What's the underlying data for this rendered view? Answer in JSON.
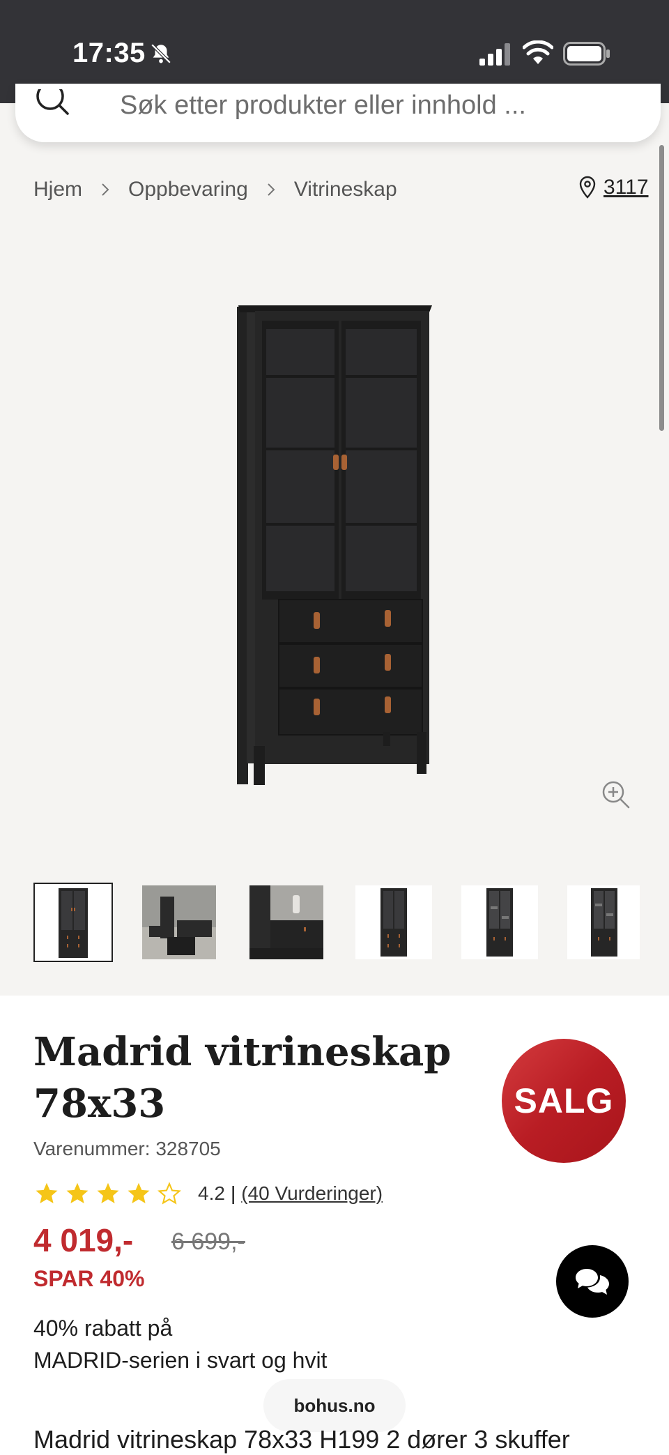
{
  "status_bar": {
    "time": "17:35"
  },
  "search": {
    "placeholder": "Søk etter produkter eller innhold ..."
  },
  "breadcrumb": [
    "Hjem",
    "Oppbevaring",
    "Vitrineskap"
  ],
  "store": {
    "number": "3117"
  },
  "product": {
    "title_line1": "Madrid vitrineskap",
    "title_line2": "78x33",
    "sku": "Varenummer: 328705",
    "rating": {
      "score": "4.2",
      "separator": "|",
      "count_label": "(40 Vurderinger)",
      "stars": 4.2
    },
    "price": "4 019,-",
    "old_price": "6 699,-",
    "save_label": "SPAR 40%",
    "promo_line1": "40% rabatt på",
    "promo_line2": "MADRID-serien i svart og hvit",
    "description": "Madrid vitrineskap 78x33 H199 2 dører 3 skuffer"
  },
  "badges": {
    "sale": "SALG"
  },
  "thumbnails": {
    "count": 6,
    "selected_index": 0
  },
  "footer": {
    "domain": "bohus.no"
  },
  "colors": {
    "accent_red": "#c02b2f",
    "status_bar": "#333337",
    "star": "#f5c518"
  },
  "icons": [
    "bell-slash-icon",
    "cellular-signal-icon",
    "wifi-icon",
    "battery-icon",
    "search-icon",
    "chevron-right-icon",
    "location-pin-icon",
    "zoom-in-icon",
    "chat-icon",
    "star-icon"
  ]
}
